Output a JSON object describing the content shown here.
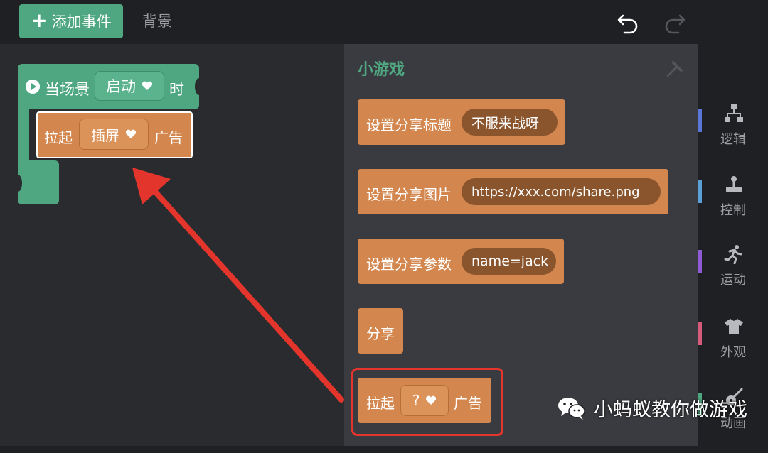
{
  "topbar": {
    "add_event_label": "添加事件",
    "background_tab": "背景"
  },
  "workspace": {
    "event_block": {
      "prefix": "当场景",
      "dropdown_value": "启动",
      "suffix": "时"
    },
    "ad_block": {
      "prefix": "拉起",
      "dropdown_value": "插屏",
      "suffix": "广告"
    }
  },
  "flyout": {
    "title": "小游戏",
    "blocks": [
      {
        "label": "设置分享标题",
        "value": "不服来战呀"
      },
      {
        "label": "设置分享图片",
        "value": "https://xxx.com/share.png"
      },
      {
        "label": "设置分享参数",
        "value": "name=jack"
      },
      {
        "label": "分享"
      },
      {
        "prefix": "拉起",
        "dropdown_value": "?",
        "suffix": "广告"
      }
    ]
  },
  "categories": [
    {
      "label": "逻辑",
      "icon": "hierarchy-icon",
      "color": "#5a76d6"
    },
    {
      "label": "控制",
      "icon": "joystick-icon",
      "color": "#5a9fd6"
    },
    {
      "label": "运动",
      "icon": "running-icon",
      "color": "#8e5ad6"
    },
    {
      "label": "外观",
      "icon": "shirt-icon",
      "color": "#d65a7a"
    },
    {
      "label": "动画",
      "icon": "guitar-icon",
      "color": "#4fa781"
    }
  ],
  "watermark": {
    "text": "小蚂蚁教你做游戏"
  },
  "colors": {
    "event_green": "#4fa781",
    "block_orange": "#d3864d",
    "highlight_red": "#e3352b"
  }
}
